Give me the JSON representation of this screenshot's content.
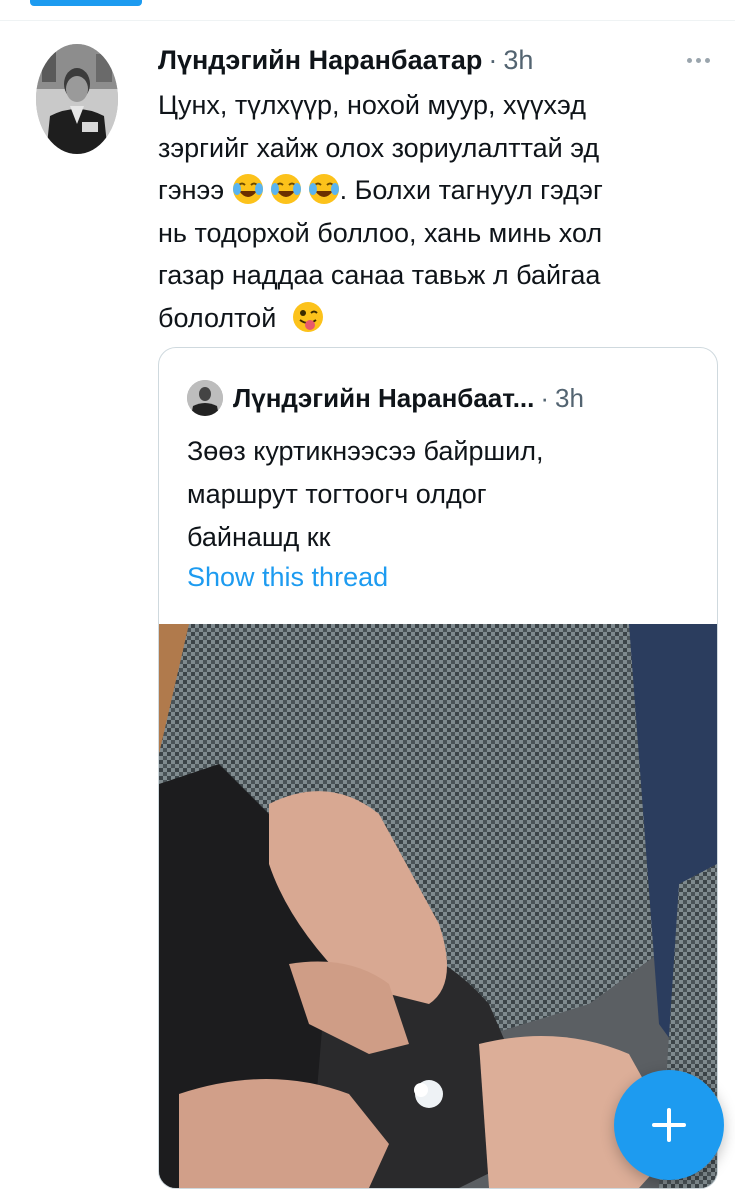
{
  "tweet": {
    "author_name": "Лүндэгийн Наранбаатар",
    "time": "3h",
    "separator": "·",
    "lines": [
      "Цунх, түлхүүр, нохой муур, хүүхэд",
      "зэргийг хайж олох зориулалттай эд",
      "гэнээ",
      ". Болхи тагнуул гэдэг",
      "нь тодорхой боллоо, хань минь хол",
      "газар наддаа санаа тавьж л байгаа",
      "бололтой"
    ],
    "emoji_after_line3": [
      "face-with-tears-of-joy-icon",
      "face-with-tears-of-joy-icon",
      "face-with-tears-of-joy-icon"
    ],
    "emoji_after_last_line": "winking-face-with-tongue-icon"
  },
  "quote": {
    "author_name": "Лүндэгийн Наранбаат...",
    "separator": "·",
    "time": "3h",
    "lines": [
      "Зөөз куртикнээсээ байршил,",
      "маршрут тогтоогч олдог",
      "байнашд кк"
    ],
    "show_thread": "Show this thread"
  },
  "colors": {
    "accent": "#1d9bf0",
    "secondary_text": "#536471",
    "border": "#cfd9de"
  }
}
